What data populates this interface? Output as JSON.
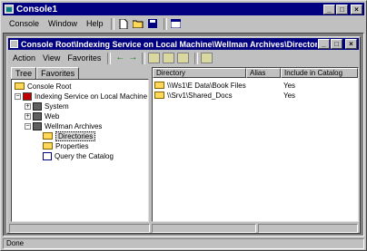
{
  "app": {
    "title": "Console1",
    "menu": [
      "Console",
      "Window",
      "Help"
    ],
    "min_glyph": "_",
    "max_glyph": "□",
    "close_glyph": "×"
  },
  "child": {
    "title": "Console Root\\Indexing Service on Local Machine\\Wellman Archives\\Directories",
    "menu": [
      "Action",
      "View",
      "Favorites"
    ],
    "back_glyph": "←",
    "forward_glyph": "→"
  },
  "tabs": [
    "Tree",
    "Favorites"
  ],
  "tree": {
    "root": "Console Root",
    "service": "Indexing Service on Local Machine",
    "catalogs": [
      "System",
      "Web",
      "Wellman Archives"
    ],
    "children": [
      "Directories",
      "Properties",
      "Query the Catalog"
    ],
    "expand_plus": "+",
    "expand_minus": "−"
  },
  "list": {
    "columns": [
      "Directory",
      "Alias",
      "Include in Catalog"
    ],
    "rows": [
      {
        "directory": "\\\\Ws1\\E Data\\Book Files",
        "alias": "",
        "include": "Yes"
      },
      {
        "directory": "\\\\Srv1\\Shared_Docs",
        "alias": "",
        "include": "Yes"
      }
    ]
  },
  "status": {
    "text": "Done"
  }
}
